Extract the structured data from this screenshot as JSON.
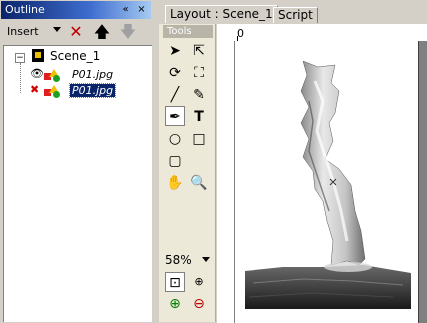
{
  "outline": {
    "title": "Outline",
    "insert_label": "Insert",
    "controls": {
      "collapse": "«",
      "close": "×"
    },
    "toolbar_icons": [
      "delete-icon",
      "move-up-icon",
      "move-down-icon"
    ],
    "tree": {
      "scene_label": "Scene_1",
      "expander": "−",
      "items": [
        {
          "label": "P01.jpg",
          "selected": false
        },
        {
          "label": "P01.jpg",
          "selected": true
        }
      ]
    }
  },
  "layout": {
    "tabs": [
      {
        "label": "Layout : Scene_1",
        "active": true
      },
      {
        "label": "Script",
        "active": false
      }
    ],
    "tools": {
      "header": "Tools",
      "zoom": "58%",
      "icons": [
        "select-arrow-icon",
        "direct-select-icon",
        "rotate-icon",
        "transform-icon",
        "line-icon",
        "pencil-icon",
        "pen-icon",
        "text-icon",
        "ellipse-icon",
        "rectangle-icon",
        "rounded-rect-icon",
        "hand-icon",
        "zoom-icon",
        "zoom-fit-icon",
        "zoom-100-icon",
        "zoom-in-icon",
        "zoom-out-icon"
      ]
    },
    "ruler_zero": "0"
  },
  "colors": {
    "title_active": "#0a246a",
    "panel_bg": "#d4d0c8",
    "selected_bg": "#0a246a"
  }
}
